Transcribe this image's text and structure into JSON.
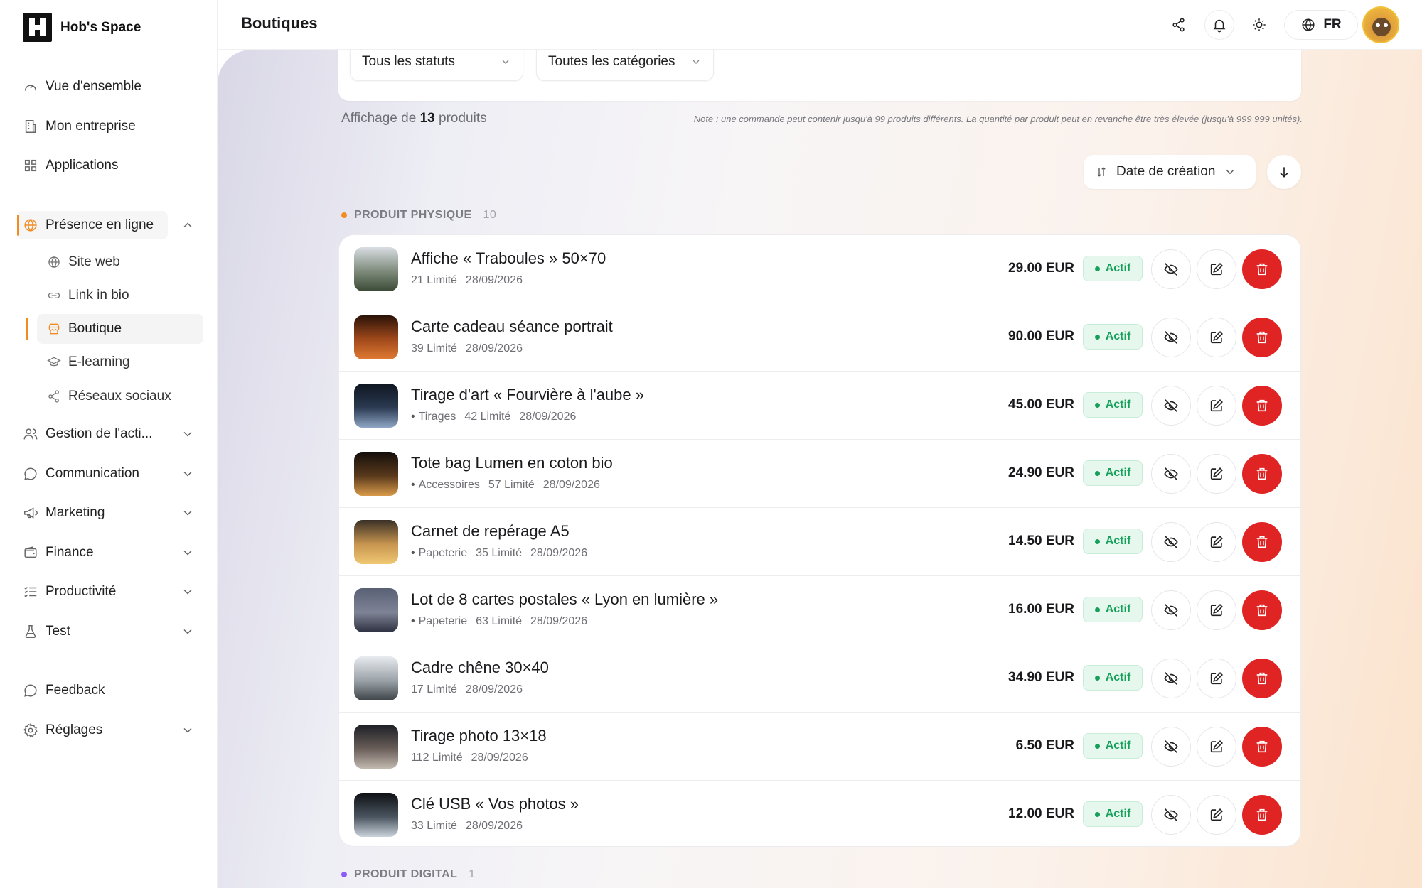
{
  "brand": {
    "name": "Hob's Space"
  },
  "sidebar": {
    "items": [
      {
        "label": "Vue d'ensemble",
        "icon": "gauge-icon"
      },
      {
        "label": "Mon entreprise",
        "icon": "building-icon"
      },
      {
        "label": "Applications",
        "icon": "grid-icon"
      },
      {
        "label": "Présence en ligne",
        "icon": "globe-icon",
        "active": true
      },
      {
        "label": "Gestion de l'acti...",
        "icon": "users-icon"
      },
      {
        "label": "Communication",
        "icon": "chat-icon"
      },
      {
        "label": "Marketing",
        "icon": "megaphone-icon"
      },
      {
        "label": "Finance",
        "icon": "wallet-icon"
      },
      {
        "label": "Productivité",
        "icon": "checklist-icon"
      },
      {
        "label": "Test",
        "icon": "flask-icon"
      },
      {
        "label": "Feedback",
        "icon": "chat-icon"
      },
      {
        "label": "Réglages",
        "icon": "gear-icon"
      }
    ],
    "subitems": [
      {
        "label": "Site web",
        "icon": "globe-icon"
      },
      {
        "label": "Link in bio",
        "icon": "link-icon"
      },
      {
        "label": "Boutique",
        "icon": "store-icon",
        "active": true
      },
      {
        "label": "E-learning",
        "icon": "graduation-cap-icon"
      },
      {
        "label": "Réseaux sociaux",
        "icon": "share-icon"
      }
    ]
  },
  "header": {
    "title": "Boutiques",
    "lang": "FR"
  },
  "filters": {
    "status": "Tous les statuts",
    "category": "Toutes les catégories"
  },
  "summary": {
    "prefix": "Affichage de",
    "count": "13",
    "suffix": "produits",
    "note": "Note : une commande peut contenir jusqu'à 99 produits différents. La quantité par produit peut en revanche être très élevée (jusqu'à 999 999 unités)."
  },
  "sort": {
    "label": "Date de création"
  },
  "sections": {
    "physical": {
      "label": "PRODUIT PHYSIQUE",
      "count": "10",
      "color": "#f28b20"
    },
    "digital": {
      "label": "PRODUIT DIGITAL",
      "count": "1",
      "color": "#8b5cf6"
    }
  },
  "products": [
    {
      "name": "Affiche « Traboules » 50×70",
      "category": "",
      "stock": "21 Limité",
      "date": "28/09/2026",
      "price": "29.00 EUR",
      "status": "Actif",
      "thumb": [
        "#d8dde2",
        "#7d8a7a",
        "#3b4a36"
      ]
    },
    {
      "name": "Carte cadeau séance portrait",
      "category": "",
      "stock": "39 Limité",
      "date": "28/09/2026",
      "price": "90.00 EUR",
      "status": "Actif",
      "thumb": [
        "#2a1208",
        "#a24a1c",
        "#e07a32"
      ]
    },
    {
      "name": "Tirage d'art « Fourvière à l'aube »",
      "category": "Tirages",
      "stock": "42 Limité",
      "date": "28/09/2026",
      "price": "45.00 EUR",
      "status": "Actif",
      "thumb": [
        "#0e1520",
        "#2b3b52",
        "#8fa6c4"
      ]
    },
    {
      "name": "Tote bag Lumen en coton bio",
      "category": "Accessoires",
      "stock": "57 Limité",
      "date": "28/09/2026",
      "price": "24.90 EUR",
      "status": "Actif",
      "thumb": [
        "#120d0a",
        "#5a3a1c",
        "#d89a4a"
      ]
    },
    {
      "name": "Carnet de repérage A5",
      "category": "Papeterie",
      "stock": "35 Limité",
      "date": "28/09/2026",
      "price": "14.50 EUR",
      "status": "Actif",
      "thumb": [
        "#3a3026",
        "#c79550",
        "#f0c872"
      ]
    },
    {
      "name": "Lot de 8 cartes postales « Lyon en lumière »",
      "category": "Papeterie",
      "stock": "63 Limité",
      "date": "28/09/2026",
      "price": "16.00 EUR",
      "status": "Actif",
      "thumb": [
        "#5a6074",
        "#7e8396",
        "#2e3140"
      ]
    },
    {
      "name": "Cadre chêne 30×40",
      "category": "",
      "stock": "17 Limité",
      "date": "28/09/2026",
      "price": "34.90 EUR",
      "status": "Actif",
      "thumb": [
        "#e8ebef",
        "#9aa2a8",
        "#3e4448"
      ]
    },
    {
      "name": "Tirage photo 13×18",
      "category": "",
      "stock": "112 Limité",
      "date": "28/09/2026",
      "price": "6.50 EUR",
      "status": "Actif",
      "thumb": [
        "#1c1f26",
        "#6a5e58",
        "#c2b9b0"
      ]
    },
    {
      "name": "Clé USB « Vos photos »",
      "category": "",
      "stock": "33 Limité",
      "date": "28/09/2026",
      "price": "12.00 EUR",
      "status": "Actif",
      "thumb": [
        "#0d1014",
        "#4b5560",
        "#c9d2da"
      ]
    }
  ]
}
